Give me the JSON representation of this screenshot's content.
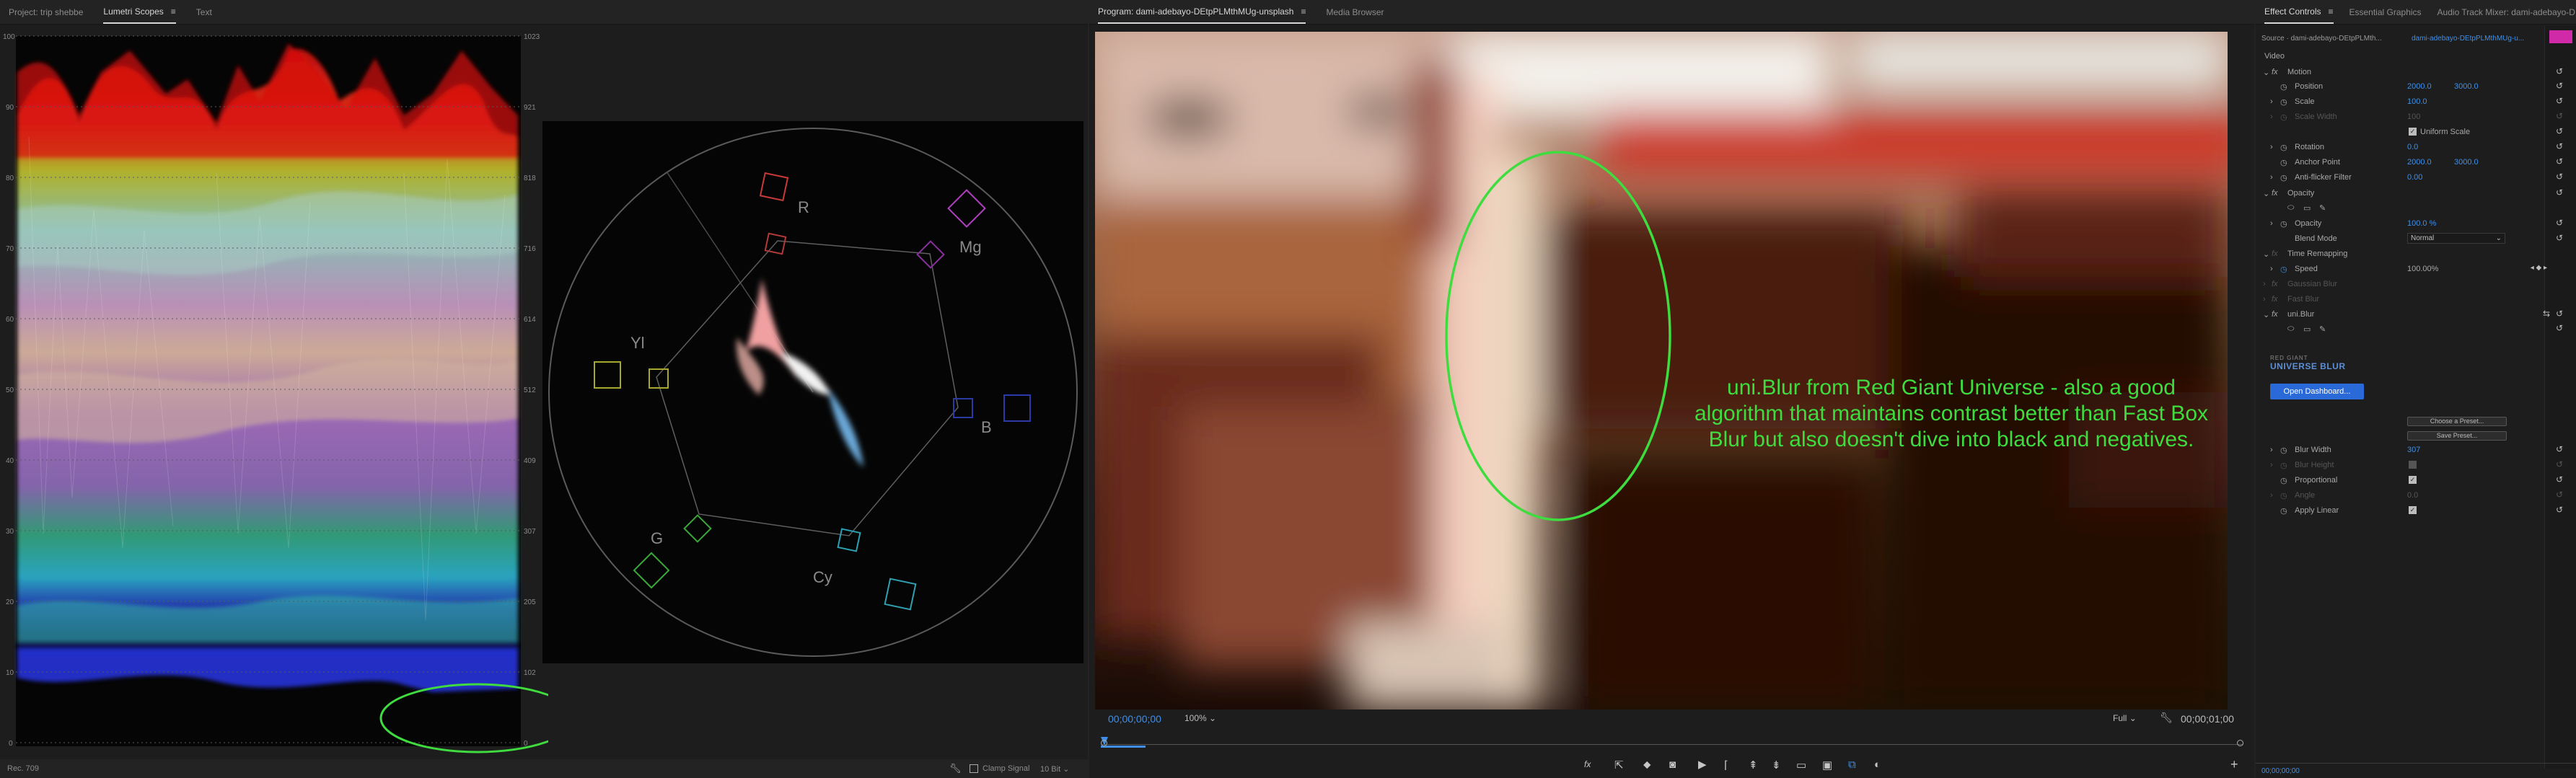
{
  "scopes_panel": {
    "tabs": [
      {
        "label": "Project: trip shebbe"
      },
      {
        "label": "Lumetri Scopes"
      },
      {
        "label": "Text"
      }
    ],
    "waveform_scale_left": [
      "100",
      "90",
      "80",
      "70",
      "60",
      "50",
      "40",
      "30",
      "20",
      "10",
      "0"
    ],
    "waveform_scale_right": [
      "1023",
      "921",
      "818",
      "716",
      "614",
      "512",
      "409",
      "307",
      "205",
      "102",
      "0"
    ],
    "vectorscope_labels": {
      "r": "R",
      "mg": "Mg",
      "b": "B",
      "cy": "Cy",
      "g": "G",
      "yl": "Yl"
    },
    "footer": {
      "rec": "Rec. 709",
      "clamp_signal": "Clamp Signal",
      "bit_depth": "10 Bit"
    }
  },
  "program_monitor": {
    "tabs": [
      {
        "label": "Program: dami-adebayo-DEtpPLMthMUg-unsplash"
      },
      {
        "label": "Media Browser"
      }
    ],
    "annotation": "uni.Blur from Red Giant Universe - also a good algorithm that maintains contrast better than Fast Box Blur but also doesn't dive into black and negatives.",
    "timecode_current": "00;00;00;00",
    "zoom": "100%",
    "resolution": "Full",
    "timecode_duration": "00;00;01;00",
    "colors": {
      "annotation": "#3fdc3f",
      "timecode": "#3f8fe8"
    }
  },
  "effect_controls": {
    "tabs": [
      {
        "label": "Effect Controls"
      },
      {
        "label": "Essential Graphics"
      },
      {
        "label": "Audio Track Mixer: dami-adebayo-DE"
      }
    ],
    "source": "Source · dami-adebayo-DEtpPLMth...",
    "sequence": "dami-adebayo-DEtpPLMthMUg-u...",
    "video_header": "Video",
    "motion": "Motion",
    "position_label": "Position",
    "position_x": "2000.0",
    "position_y": "3000.0",
    "scale_label": "Scale",
    "scale_value": "100.0",
    "scale_width_label": "Scale Width",
    "scale_width_value": "100",
    "uniform_scale": "Uniform Scale",
    "rotation_label": "Rotation",
    "rotation_value": "0.0",
    "anchor_label": "Anchor Point",
    "anchor_x": "2000.0",
    "anchor_y": "3000.0",
    "antiflicker_label": "Anti-flicker Filter",
    "antiflicker_value": "0.00",
    "opacity_header": "Opacity",
    "opacity_label": "Opacity",
    "opacity_value": "100.0 %",
    "blend_label": "Blend Mode",
    "blend_value": "Normal",
    "time_remap": "Time Remapping",
    "speed_label": "Speed",
    "speed_value": "100.00%",
    "gaussian": "Gaussian Blur",
    "fast_blur": "Fast Blur",
    "uniblur": "uni.Blur",
    "red_giant": "RED GIANT",
    "universe_blur": "UNIVERSE BLUR",
    "open_dashboard": "Open Dashboard...",
    "choose_preset": "Choose a Preset...",
    "save_preset": "Save Preset...",
    "blur_width_label": "Blur Width",
    "blur_width_value": "307",
    "blur_height_label": "Blur Height",
    "proportional_label": "Proportional",
    "angle_label": "Angle",
    "angle_value": "0.0",
    "apply_linear_label": "Apply Linear",
    "footer_timecode": "00;00;00;00"
  }
}
